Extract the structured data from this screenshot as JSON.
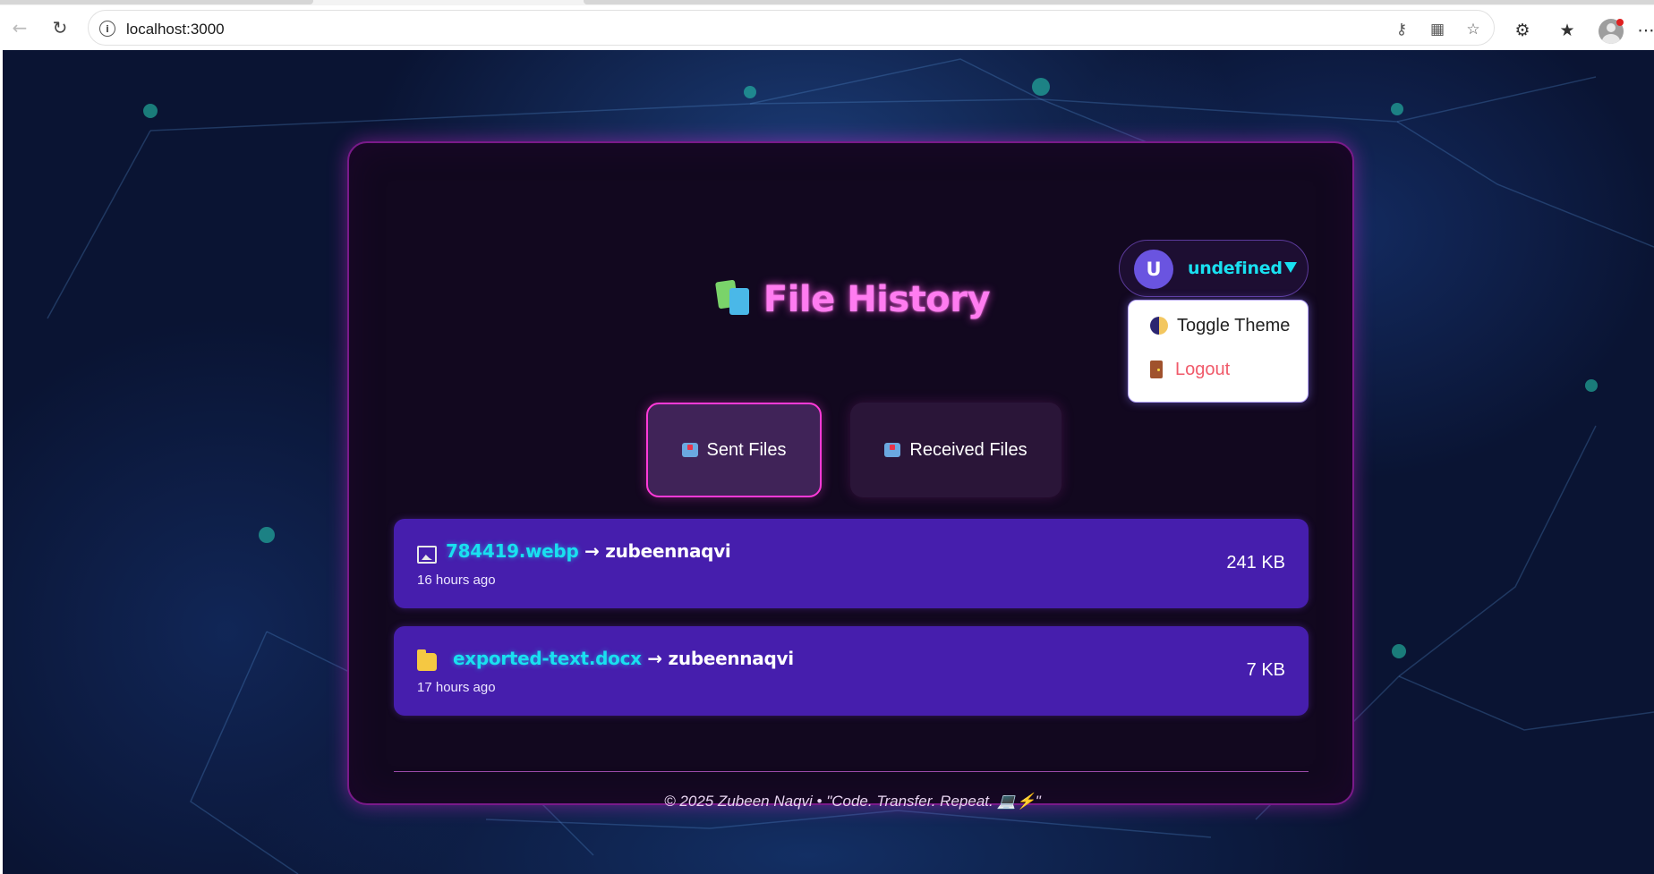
{
  "browser": {
    "url": "localhost:3000",
    "icons": [
      "back-icon",
      "reload-icon",
      "info-icon",
      "key-icon",
      "apps-icon",
      "star-icon",
      "extensions-icon",
      "favorites-icon",
      "profile-icon",
      "more-icon"
    ]
  },
  "user": {
    "avatar_initial": "U",
    "name": "undefined"
  },
  "menu": {
    "items": [
      {
        "label": "Toggle Theme",
        "icon": "theme-icon",
        "color": "#222222"
      },
      {
        "label": "Logout",
        "icon": "door-icon",
        "color": "#f05a6a"
      }
    ]
  },
  "page": {
    "title": "File History",
    "title_icon": "books-icon",
    "tabs": [
      {
        "label": "Sent Files",
        "icon": "outbox-icon",
        "active": true
      },
      {
        "label": "Received Files",
        "icon": "inbox-icon",
        "active": false
      }
    ]
  },
  "files": [
    {
      "icon": "image-icon",
      "name": "784419.webp",
      "arrow": "→",
      "recipient": "zubeennaqvi",
      "time": "16 hours ago",
      "size": "241 KB"
    },
    {
      "icon": "folder-icon",
      "name": "exported-text.docx",
      "arrow": "→",
      "recipient": "zubeennaqvi",
      "time": "17 hours ago",
      "size": "7 KB"
    }
  ],
  "footer": {
    "text": "© 2025 Zubeen Naqvi • \"Code. Transfer. Repeat. 💻⚡\""
  },
  "colors": {
    "accent_cyan": "#19e0f0",
    "accent_pink": "#ff7cf0",
    "row_purple": "#461ead",
    "card_bg": "#12081f"
  }
}
